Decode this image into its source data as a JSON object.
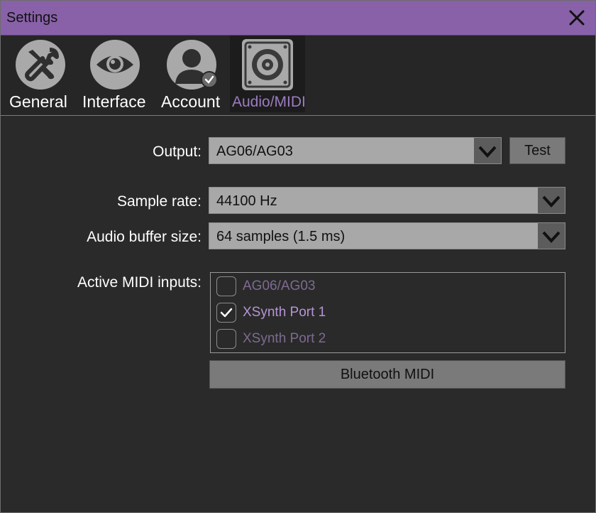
{
  "window": {
    "title": "Settings"
  },
  "tabs": [
    {
      "label": "General",
      "icon": "wrench-screwdriver-icon"
    },
    {
      "label": "Interface",
      "icon": "eye-icon"
    },
    {
      "label": "Account",
      "icon": "user-icon"
    },
    {
      "label": "Audio/MIDI",
      "icon": "speaker-icon",
      "active": true
    }
  ],
  "audio": {
    "output_label": "Output:",
    "output_value": "AG06/AG03",
    "test_label": "Test",
    "sample_rate_label": "Sample rate:",
    "sample_rate_value": "44100 Hz",
    "buffer_label": "Audio buffer size:",
    "buffer_value": "64 samples (1.5 ms)"
  },
  "midi": {
    "label": "Active MIDI inputs:",
    "inputs": [
      {
        "name": "AG06/AG03",
        "checked": false
      },
      {
        "name": "XSynth Port 1",
        "checked": true
      },
      {
        "name": "XSynth Port 2",
        "checked": false
      }
    ],
    "bluetooth_label": "Bluetooth MIDI"
  },
  "colors": {
    "accent": "#8861a8",
    "active_tab_text": "#9b7cc0",
    "background": "#2a2a2a"
  }
}
